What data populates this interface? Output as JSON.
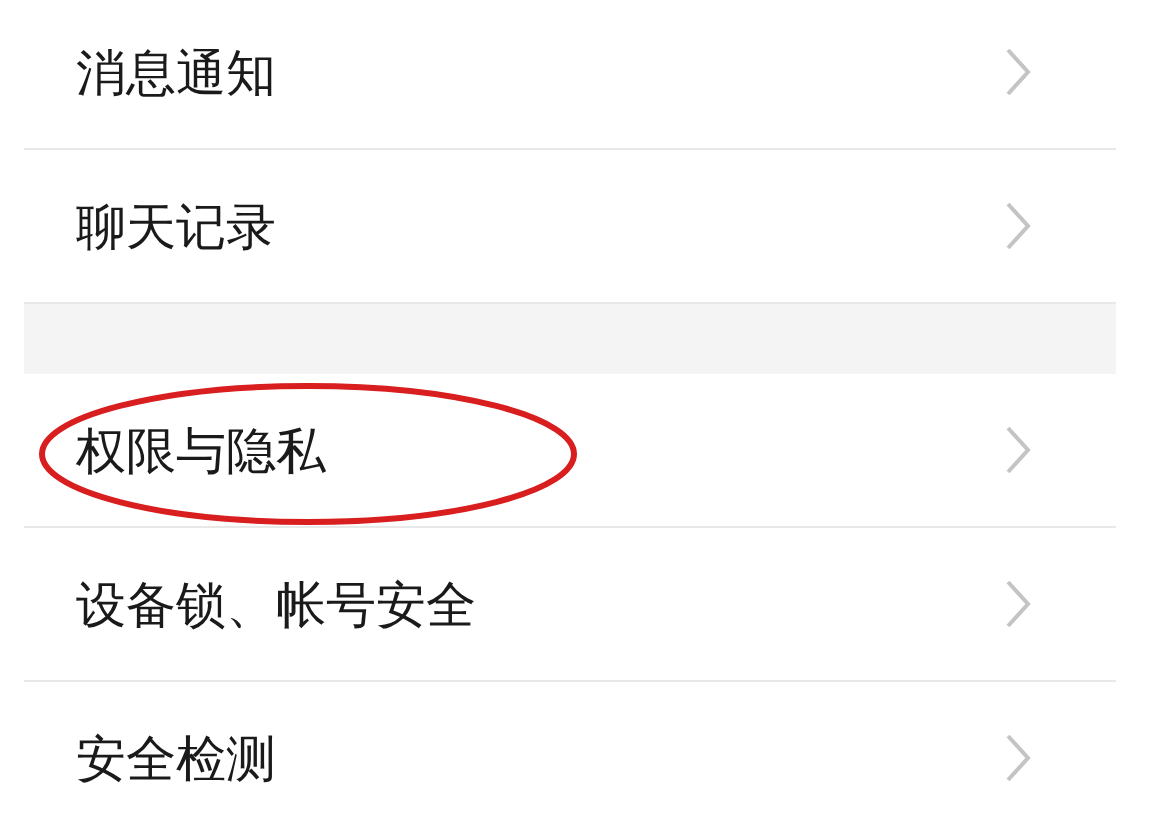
{
  "groups": [
    {
      "items": [
        {
          "label": "消息通知",
          "circled": false
        },
        {
          "label": "聊天记录",
          "circled": false
        }
      ]
    },
    {
      "items": [
        {
          "label": "权限与隐私",
          "circled": true
        },
        {
          "label": "设备锁、帐号安全",
          "circled": false
        },
        {
          "label": "安全检测",
          "circled": false
        }
      ]
    }
  ]
}
